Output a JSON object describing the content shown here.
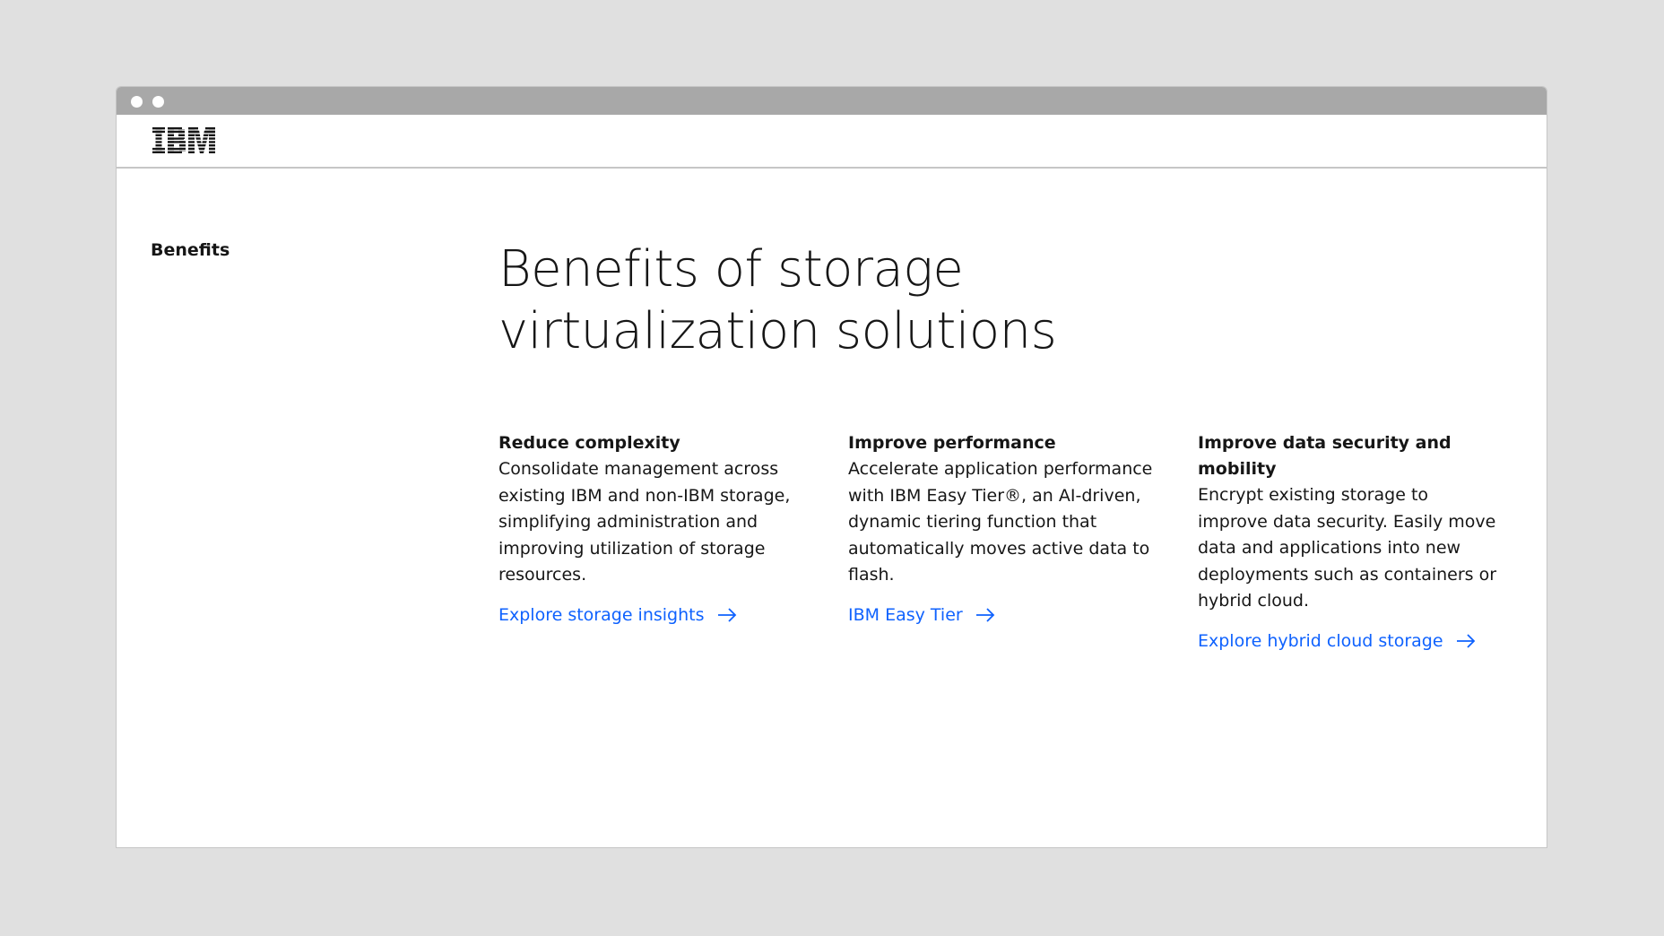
{
  "window": {
    "brand": "IBM"
  },
  "sidebar": {
    "label": "Benefits"
  },
  "main": {
    "heading_line1": "Benefits of storage",
    "heading_line2": "virtualization solutions",
    "cards": [
      {
        "title": "Reduce complexity",
        "body": "Consolidate management across existing IBM and non-IBM storage, simplifying administration and improving utilization of storage resources.",
        "link": "Explore storage insights"
      },
      {
        "title": "Improve performance",
        "body": "Accelerate application performance with IBM Easy Tier®, an AI-driven, dynamic tiering function that automatically moves active data to flash.",
        "link": "IBM Easy Tier"
      },
      {
        "title": "Improve data security and mobility",
        "body": "Encrypt existing storage to improve data security. Easily move data and applications into new deployments such as containers or hybrid cloud.",
        "link": "Explore hybrid cloud storage"
      }
    ]
  },
  "colors": {
    "link": "#0f62fe",
    "text": "#161616",
    "titlebar": "#a8a8a8",
    "background": "#e0e0e0"
  },
  "icons": {
    "link_arrow": "arrow-right-icon",
    "window_controls": "window-dot-icon"
  }
}
